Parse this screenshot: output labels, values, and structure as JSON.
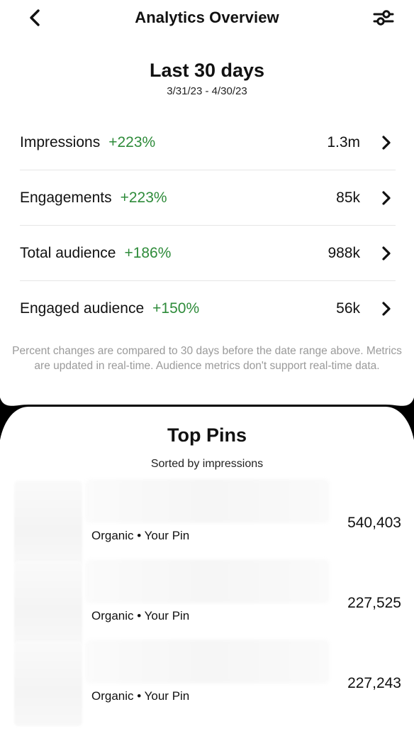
{
  "header": {
    "title": "Analytics Overview",
    "back_icon": "chevron-left-icon",
    "filter_icon": "sliders-icon"
  },
  "range": {
    "title": "Last 30 days",
    "dates": "3/31/23 - 4/30/23"
  },
  "metrics": [
    {
      "name": "Impressions",
      "change": "+223%",
      "value": "1.3m"
    },
    {
      "name": "Engagements",
      "change": "+223%",
      "value": "85k"
    },
    {
      "name": "Total audience",
      "change": "+186%",
      "value": "988k"
    },
    {
      "name": "Engaged audience",
      "change": "+150%",
      "value": "56k"
    }
  ],
  "footnote": "Percent changes are compared to 30 days before the date range above. Metrics are updated in real-time. Audience metrics don't support real-time data.",
  "top_pins": {
    "title": "Top Pins",
    "subtitle": "Sorted by impressions",
    "items": [
      {
        "source": "Organic • Your Pin",
        "impressions": "540,403"
      },
      {
        "source": "Organic • Your Pin",
        "impressions": "227,525"
      },
      {
        "source": "Organic • Your Pin",
        "impressions": "227,243"
      }
    ]
  },
  "colors": {
    "positive": "#2e8b3a",
    "text": "#111111",
    "muted": "#9a9a9a",
    "divider": "#e6e6e6"
  }
}
